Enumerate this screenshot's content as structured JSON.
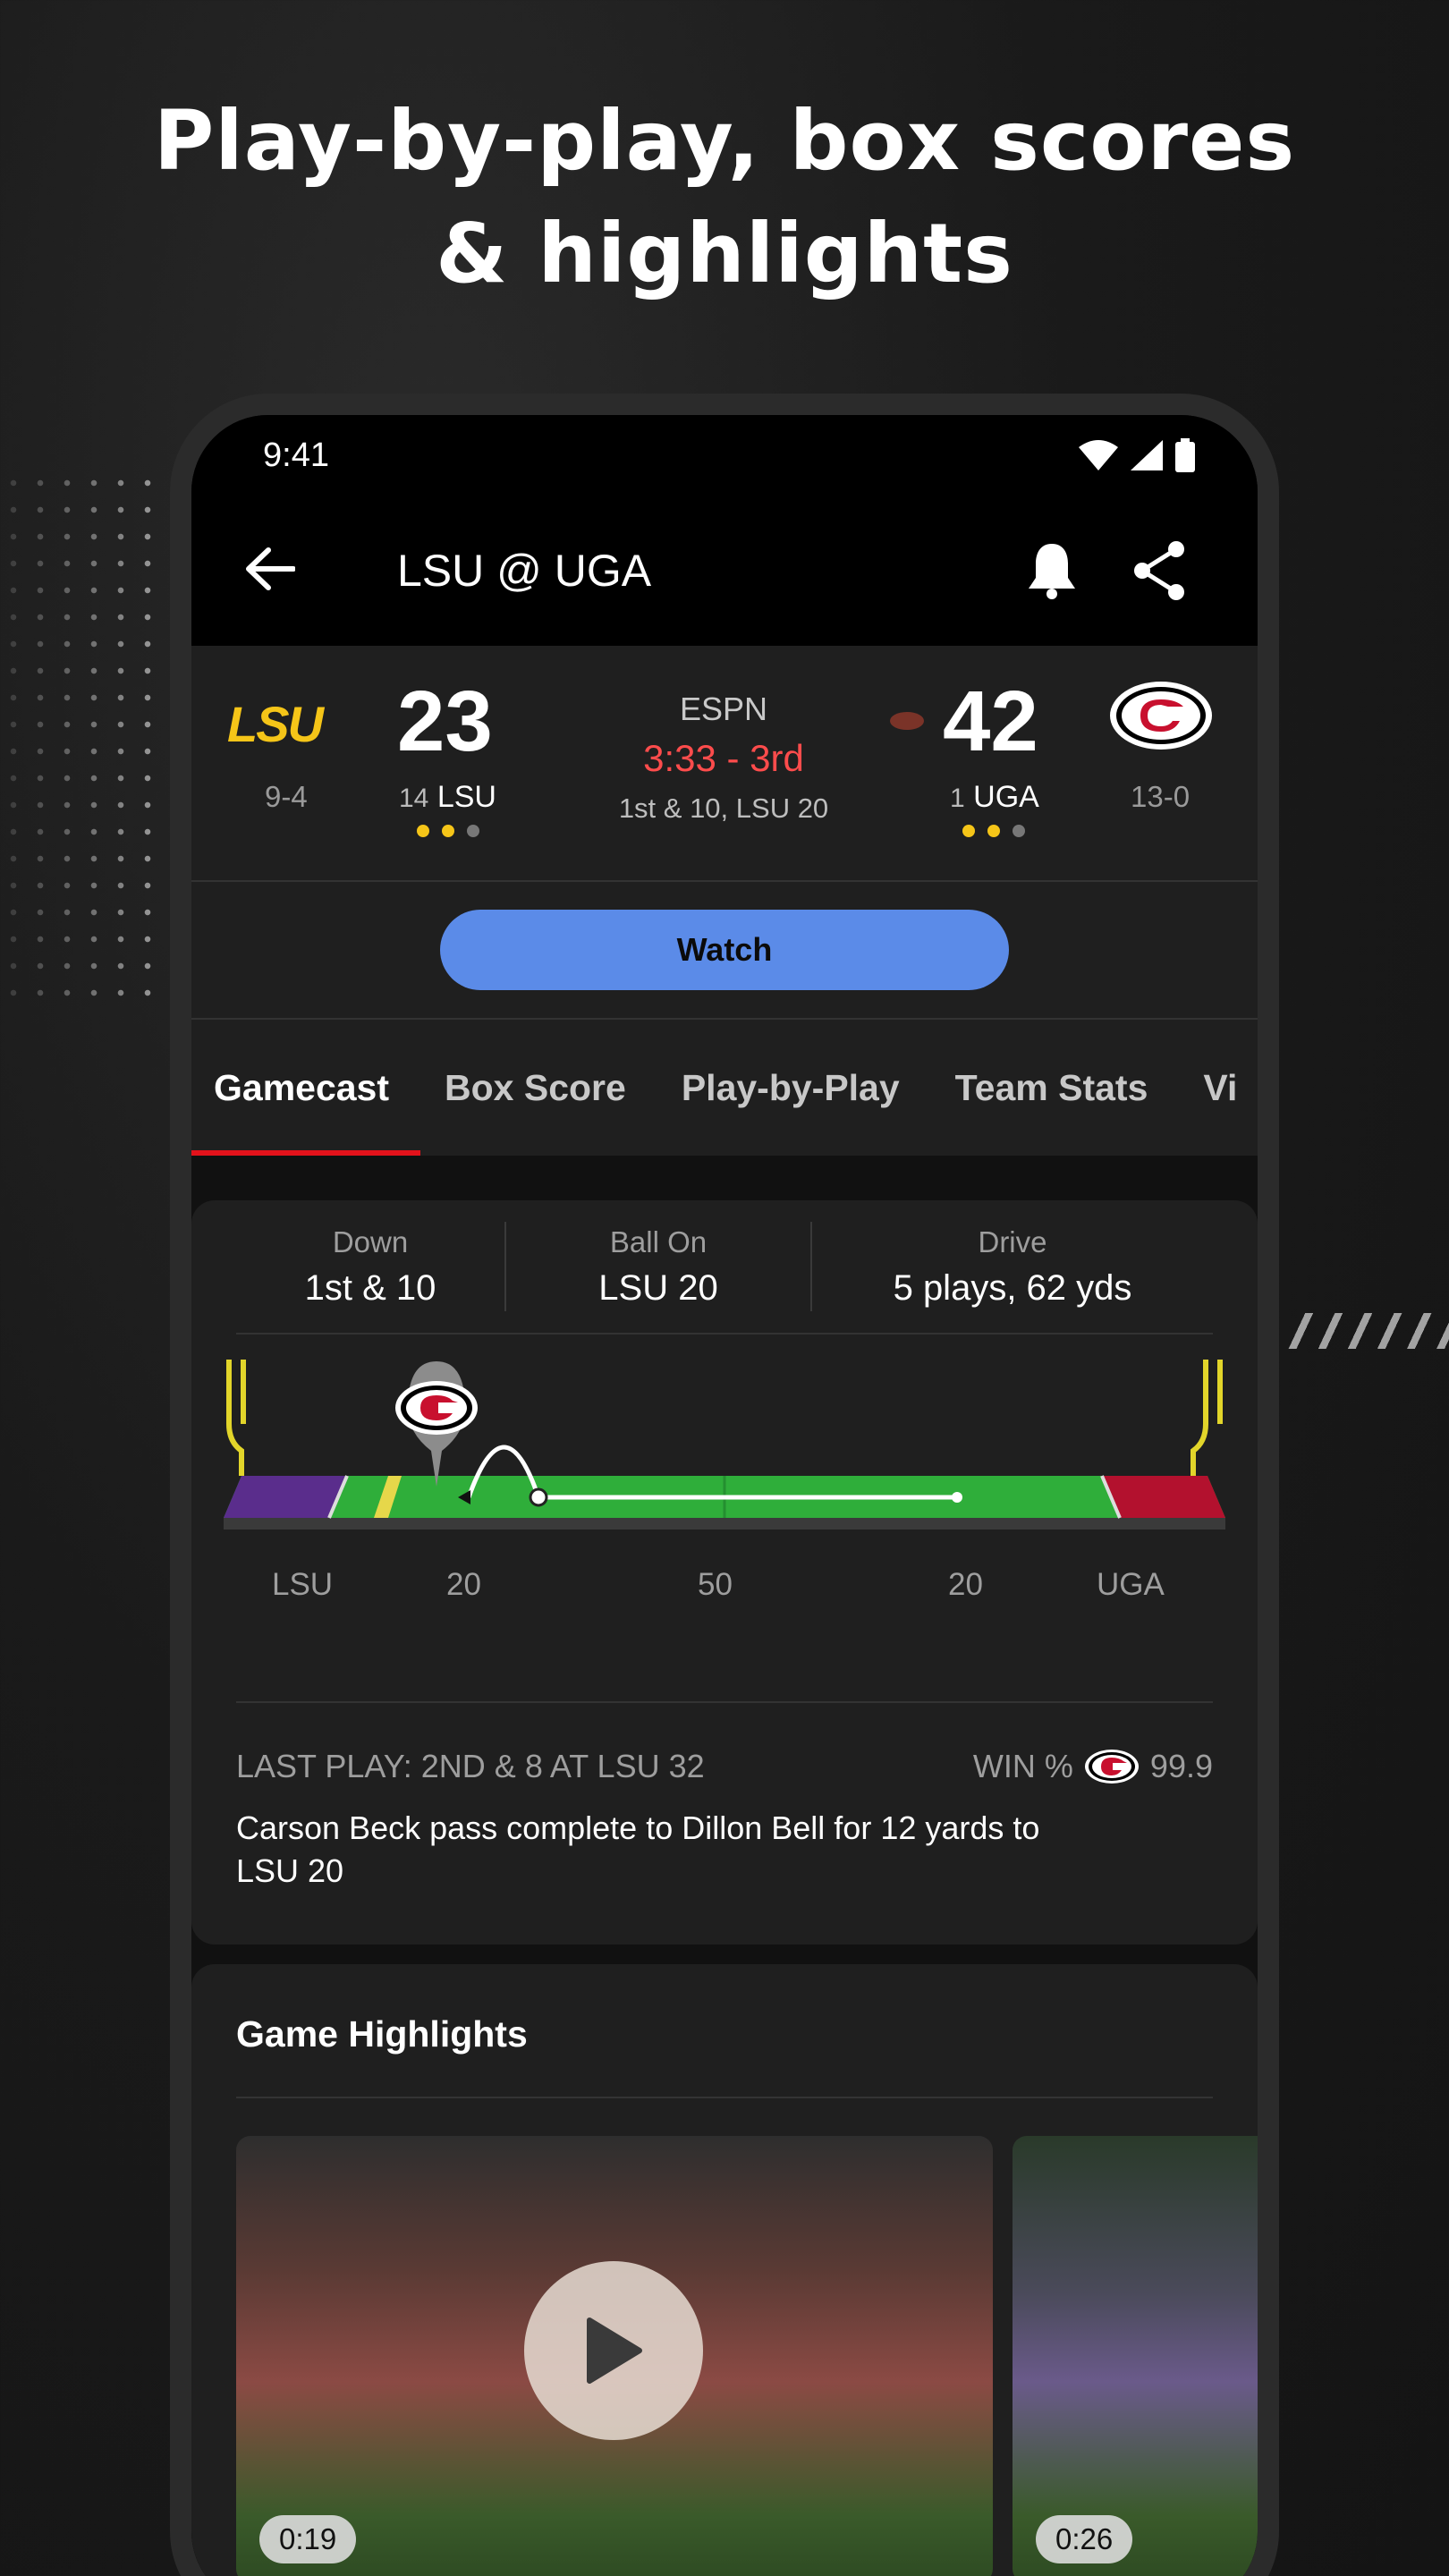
{
  "headline": {
    "line1": "Play-by-play, box scores",
    "line2": "& highlights"
  },
  "status": {
    "time": "9:41"
  },
  "appbar": {
    "title": "LSU @ UGA"
  },
  "score": {
    "away": {
      "abbr": "LSU",
      "record": "9-4",
      "score": "23",
      "rank": "14",
      "name": "LSU"
    },
    "home": {
      "abbr": "UGA",
      "record": "13-0",
      "score": "42",
      "rank": "1",
      "name": "UGA"
    },
    "network": "ESPN",
    "clock": "3:33 - 3rd",
    "situation": "1st & 10, LSU 20"
  },
  "watch_label": "Watch",
  "tabs": [
    "Gamecast",
    "Box Score",
    "Play-by-Play",
    "Team Stats",
    "Vi"
  ],
  "drive": {
    "down_label": "Down",
    "down_value": "1st & 10",
    "ballon_label": "Ball On",
    "ballon_value": "LSU 20",
    "drive_label": "Drive",
    "drive_value": "5 plays, 62 yds"
  },
  "field": {
    "labels": [
      "LSU",
      "20",
      "50",
      "20",
      "UGA"
    ]
  },
  "last_play": {
    "header": "LAST PLAY: 2ND & 8 AT LSU 32",
    "win_label": "WIN %",
    "win_value": "99.9",
    "text": "Carson Beck pass complete to Dillon Bell for 12 yards to LSU 20"
  },
  "highlights": {
    "title": "Game Highlights",
    "videos": [
      {
        "duration": "0:19"
      },
      {
        "duration": "0:26"
      }
    ]
  },
  "colors": {
    "accent": "#e3121b",
    "watch": "#5b8be8",
    "lsu_gold": "#f5c518",
    "clock_red": "#ff4c4c"
  }
}
